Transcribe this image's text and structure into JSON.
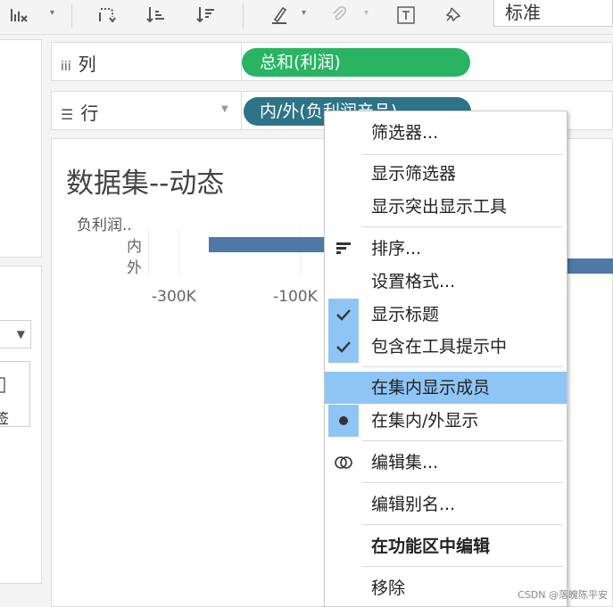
{
  "toolbar": {
    "icons": [
      "chart-clear-icon",
      "dropdown-icon",
      "swap-icon",
      "sort-ascending-icon",
      "sort-descending-icon",
      "highlight-pen-icon",
      "dropdown-icon",
      "attach-icon",
      "dropdown-icon",
      "text-label-icon",
      "pin-icon"
    ],
    "fit_value": "标准"
  },
  "shelves": {
    "columns": {
      "label": "列",
      "pill": "总和(利润)"
    },
    "rows": {
      "label": "行",
      "pill": "内/外(负利润产品)"
    }
  },
  "left_panel": {
    "card_label": "签"
  },
  "view": {
    "title": "数据集--动态",
    "row_header": "负利润..",
    "rows": [
      "内",
      "外"
    ],
    "ticks": [
      "-300K",
      "-100K"
    ]
  },
  "chart_data": {
    "type": "bar",
    "categories": [
      "内",
      "外"
    ],
    "axis_ticks": [
      "-300K",
      "-100K"
    ],
    "ylabel": "负利润..",
    "colors": {
      "bar": "#4e79a7"
    }
  },
  "menu": {
    "items": [
      {
        "label": "筛选器..."
      },
      {
        "label": "显示筛选器"
      },
      {
        "label": "显示突出显示工具"
      },
      {
        "label": "排序..."
      },
      {
        "label": "设置格式..."
      },
      {
        "label": "显示标题"
      },
      {
        "label": "包含在工具提示中"
      },
      {
        "label": "在集内显示成员"
      },
      {
        "label": "在集内/外显示"
      },
      {
        "label": "编辑集..."
      },
      {
        "label": "编辑别名..."
      },
      {
        "label": "在功能区中编辑"
      },
      {
        "label": "移除"
      }
    ]
  },
  "watermark": "CSDN @落魄陈平安",
  "colors": {
    "green_pill": "#28b463",
    "blue_pill": "#2e7488",
    "menu_highlight": "#8ec5f5"
  }
}
